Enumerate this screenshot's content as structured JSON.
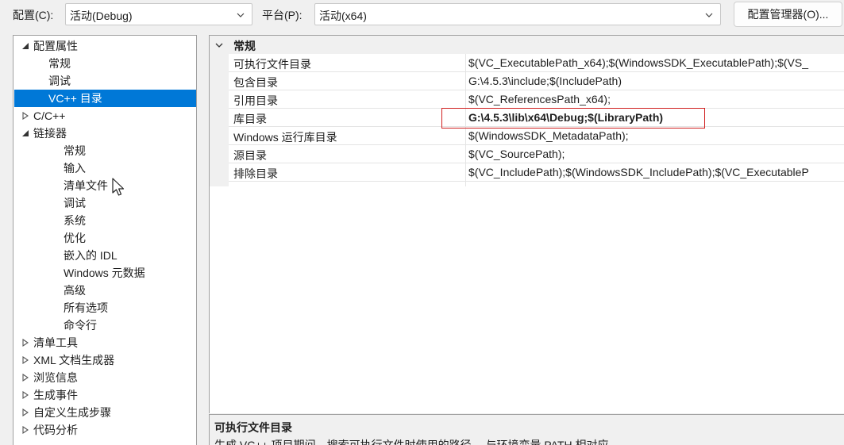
{
  "toolbar": {
    "config_label": "配置(C):",
    "config_value": "活动(Debug)",
    "platform_label": "平台(P):",
    "platform_value": "活动(x64)",
    "manager_button": "配置管理器(O)..."
  },
  "tree": {
    "items": [
      {
        "label": "配置属性",
        "expander": "expanded"
      },
      {
        "label": "常规"
      },
      {
        "label": "调试"
      },
      {
        "label": "VC++ 目录",
        "selected": true
      },
      {
        "label": "C/C++",
        "expander": "collapsed"
      },
      {
        "label": "链接器",
        "expander": "expanded"
      },
      {
        "label": "常规"
      },
      {
        "label": "输入"
      },
      {
        "label": "清单文件"
      },
      {
        "label": "调试"
      },
      {
        "label": "系统"
      },
      {
        "label": "优化"
      },
      {
        "label": "嵌入的 IDL"
      },
      {
        "label": "Windows 元数据"
      },
      {
        "label": "高级"
      },
      {
        "label": "所有选项"
      },
      {
        "label": "命令行"
      },
      {
        "label": "清单工具",
        "expander": "collapsed"
      },
      {
        "label": "XML 文档生成器",
        "expander": "collapsed"
      },
      {
        "label": "浏览信息",
        "expander": "collapsed"
      },
      {
        "label": "生成事件",
        "expander": "collapsed"
      },
      {
        "label": "自定义生成步骤",
        "expander": "collapsed"
      },
      {
        "label": "代码分析",
        "expander": "collapsed"
      }
    ]
  },
  "grid": {
    "category": "常规",
    "rows": [
      {
        "name": "可执行文件目录",
        "value": "$(VC_ExecutablePath_x64);$(WindowsSDK_ExecutablePath);$(VS_"
      },
      {
        "name": "包含目录",
        "value": "G:\\4.5.3\\include;$(IncludePath)"
      },
      {
        "name": "引用目录",
        "value": "$(VC_ReferencesPath_x64);"
      },
      {
        "name": "库目录",
        "value": "G:\\4.5.3\\lib\\x64\\Debug;$(LibraryPath)",
        "bold": true
      },
      {
        "name": "Windows 运行库目录",
        "value": "$(WindowsSDK_MetadataPath);"
      },
      {
        "name": "源目录",
        "value": "$(VC_SourcePath);"
      },
      {
        "name": "排除目录",
        "value": "$(VC_IncludePath);$(WindowsSDK_IncludePath);$(VC_ExecutableP"
      }
    ]
  },
  "description": {
    "title": "可执行文件目录",
    "text": "生成 VC++ 项目期间，搜索可执行文件时使用的路径。 与环境变量 PATH 相对应。"
  },
  "colors": {
    "selection": "#0078d7",
    "highlight_border": "#d01f1f"
  }
}
